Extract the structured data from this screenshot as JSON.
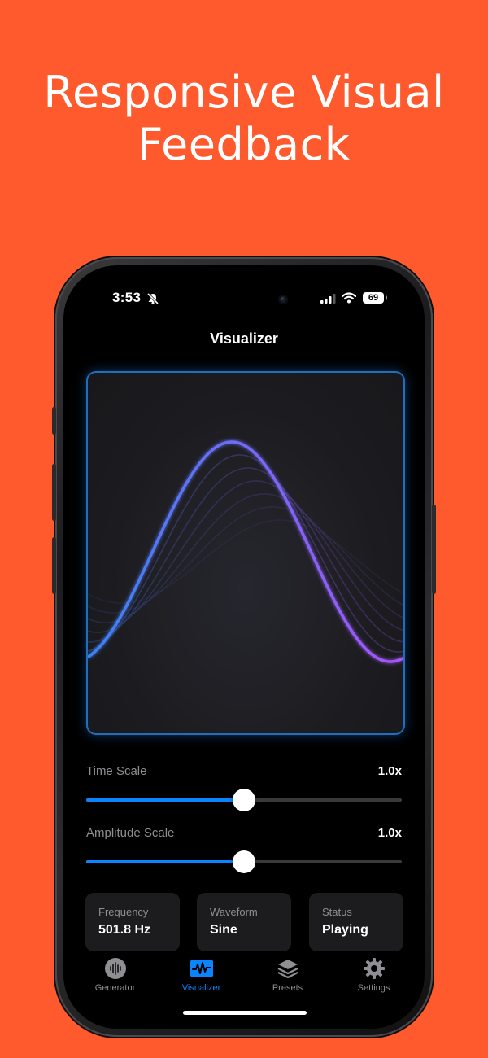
{
  "headline": {
    "line1": "Responsive Visual",
    "line2": "Feedback"
  },
  "status_bar": {
    "time": "3:53",
    "battery": "69"
  },
  "nav": {
    "title": "Visualizer"
  },
  "controls": {
    "time_scale": {
      "label": "Time Scale",
      "value_text": "1.0x",
      "fraction": 0.5
    },
    "amplitude_scale": {
      "label": "Amplitude Scale",
      "value_text": "1.0x",
      "fraction": 0.5
    }
  },
  "info": {
    "frequency": {
      "label": "Frequency",
      "value": "501.8 Hz"
    },
    "waveform": {
      "label": "Waveform",
      "value": "Sine"
    },
    "status": {
      "label": "Status",
      "value": "Playing"
    }
  },
  "tabs": [
    {
      "label": "Generator",
      "icon": "waveform-circle-icon"
    },
    {
      "label": "Visualizer",
      "icon": "oscilloscope-icon"
    },
    {
      "label": "Presets",
      "icon": "stack-icon"
    },
    {
      "label": "Settings",
      "icon": "gear-icon"
    }
  ],
  "active_tab": 1,
  "colors": {
    "background": "#FF5A2E",
    "accent": "#0A84FF",
    "wave_start": "#3B82F6",
    "wave_end": "#A855F7",
    "card_border": "#1E6FBF"
  }
}
